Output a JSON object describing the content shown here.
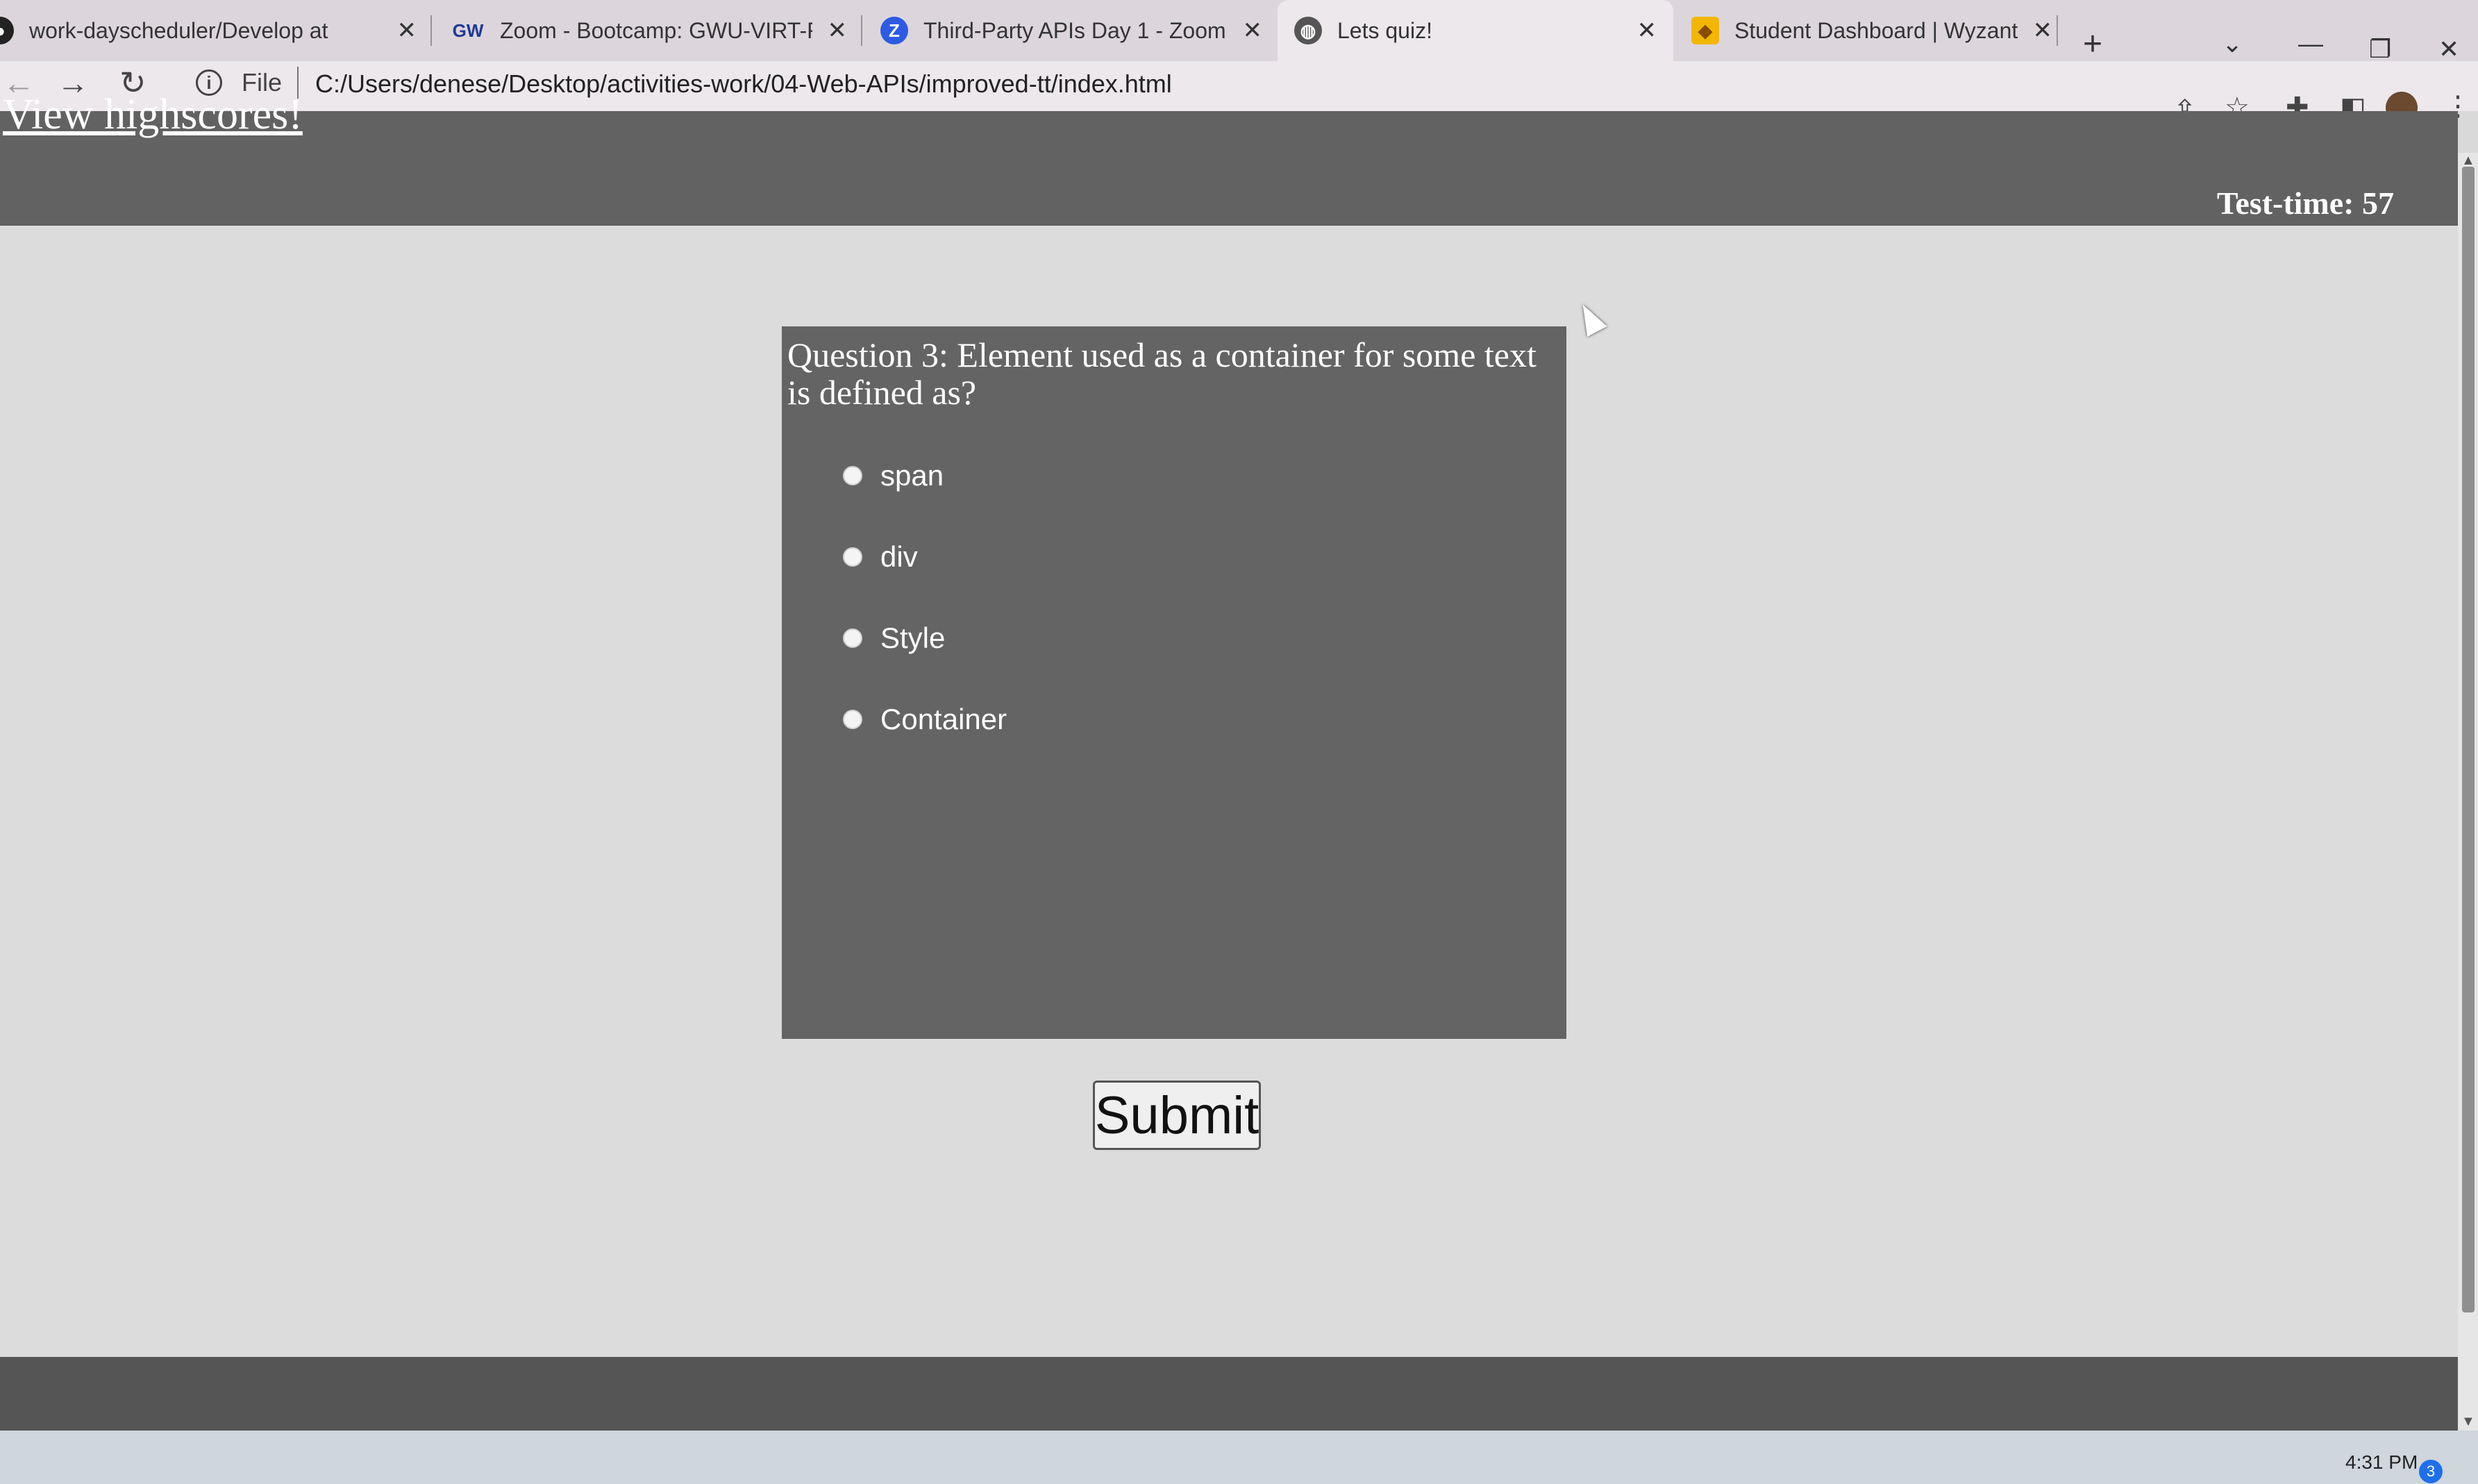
{
  "browser": {
    "tabs": [
      {
        "title": "work-dayscheduler/Develop at",
        "icon": "github-icon",
        "close": "✕"
      },
      {
        "title": "Zoom - Bootcamp: GWU-VIRT-F",
        "icon": "gw-icon",
        "icon_text": "GW",
        "close": "✕"
      },
      {
        "title": "Third-Party APIs Day 1 - Zoom",
        "icon": "zoom-icon",
        "icon_text": "Z",
        "close": "✕"
      },
      {
        "title": "Lets quiz!",
        "icon": "globe-icon",
        "close": "✕"
      },
      {
        "title": "Student Dashboard | Wyzant Tu",
        "icon": "wyzant-icon",
        "close": "✕"
      }
    ],
    "new_tab": "+",
    "address": {
      "scheme_label": "File",
      "url": "C:/Users/denese/Desktop/activities-work/04-Web-APIs/improved-tt/index.html"
    }
  },
  "page": {
    "highscores_link": "View highscores!",
    "timer": "Test-time: 57",
    "question": "Question 3: Element used as a container for some text is defined as?",
    "answers": [
      "span",
      "div",
      "Style",
      "Container"
    ],
    "submit_label": "Submit"
  },
  "taskbar": {
    "clock": "4:31 PM",
    "notification_count": "3"
  },
  "colors": {
    "header_bar": "#636262",
    "quiz_card": "#646464",
    "page_bg": "#dcdcdc",
    "zoom_blue": "#2d5be3",
    "wyzant_yellow": "#f2b705"
  }
}
